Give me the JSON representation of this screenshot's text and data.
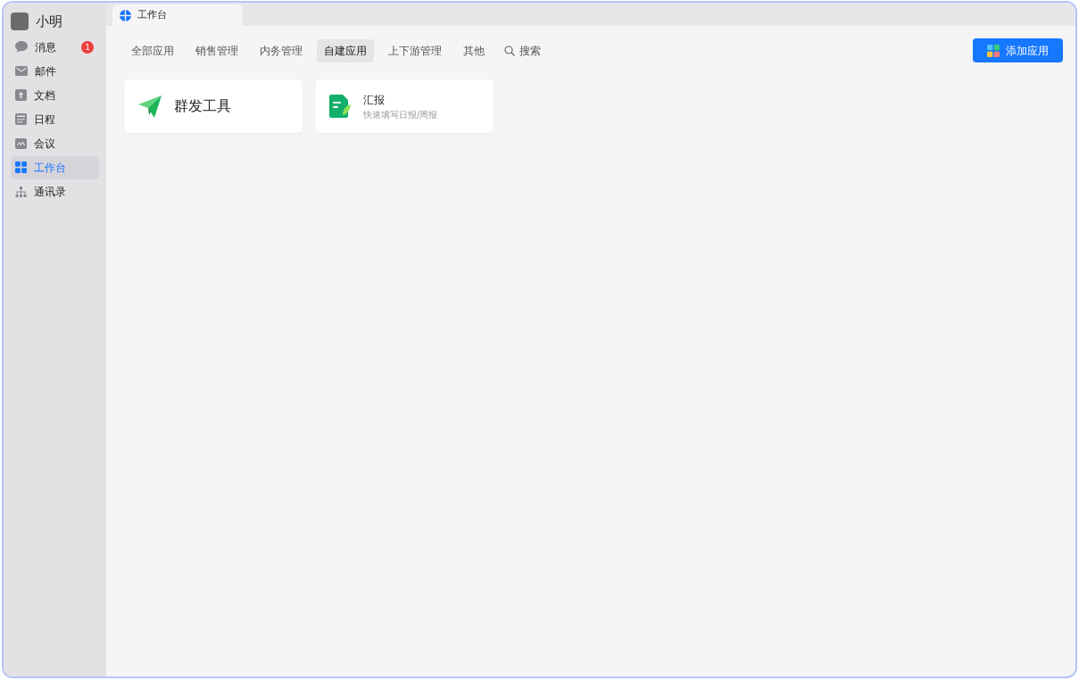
{
  "user": {
    "name": "小明"
  },
  "sidebar": {
    "items": [
      {
        "label": "消息",
        "kind": "chat",
        "selected": false,
        "badge": "1"
      },
      {
        "label": "邮件",
        "kind": "mail",
        "selected": false
      },
      {
        "label": "文档",
        "kind": "doc",
        "selected": false
      },
      {
        "label": "日程",
        "kind": "calendar",
        "selected": false
      },
      {
        "label": "会议",
        "kind": "meeting",
        "selected": false
      },
      {
        "label": "工作台",
        "kind": "grid",
        "selected": true
      },
      {
        "label": "通讯录",
        "kind": "org",
        "selected": false
      }
    ]
  },
  "tabs": [
    {
      "label": "工作台",
      "selected": true
    }
  ],
  "categories": [
    {
      "label": "全部应用",
      "selected": false
    },
    {
      "label": "销售管理",
      "selected": false
    },
    {
      "label": "内务管理",
      "selected": false
    },
    {
      "label": "自建应用",
      "selected": true
    },
    {
      "label": "上下游管理",
      "selected": false
    },
    {
      "label": "其他",
      "selected": false
    }
  ],
  "search": {
    "label": "搜索"
  },
  "add_button": {
    "label": "添加应用"
  },
  "apps": [
    {
      "kind": "large",
      "title": "群发工具"
    },
    {
      "kind": "small",
      "title": "汇报",
      "subtitle": "快速填写日报/周报"
    }
  ]
}
